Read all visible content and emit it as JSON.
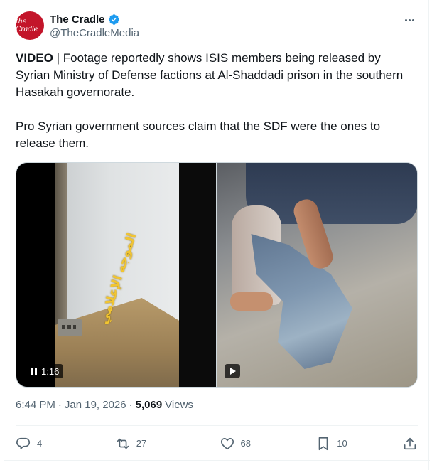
{
  "author": {
    "display_name": "The Cradle",
    "handle": "@TheCradleMedia",
    "avatar_text": "the Cradle",
    "verified": true
  },
  "tweet": {
    "label": "VIDEO",
    "text_line1": " | Footage reportedly shows ISIS members being released by Syrian Ministry of Defense factions at Al-Shaddadi prison in the southern Hasakah governorate.",
    "text_para2": "Pro Syrian government sources claim that the SDF were the ones to release them."
  },
  "media": {
    "left_duration": "1:16",
    "overlay_text": "الموجه الإعلامي"
  },
  "meta": {
    "time": "6:44 PM",
    "separator": "·",
    "date": "Jan 19, 2026",
    "views_count": "5,069",
    "views_label": "Views"
  },
  "actions": {
    "replies": "4",
    "retweets": "27",
    "likes": "68",
    "bookmarks": "10"
  },
  "colors": {
    "text": "#0f1419",
    "secondary": "#536471",
    "verified": "#1d9bf0",
    "avatar_bg": "#c3152a",
    "overlay_text": "#f2c531"
  }
}
